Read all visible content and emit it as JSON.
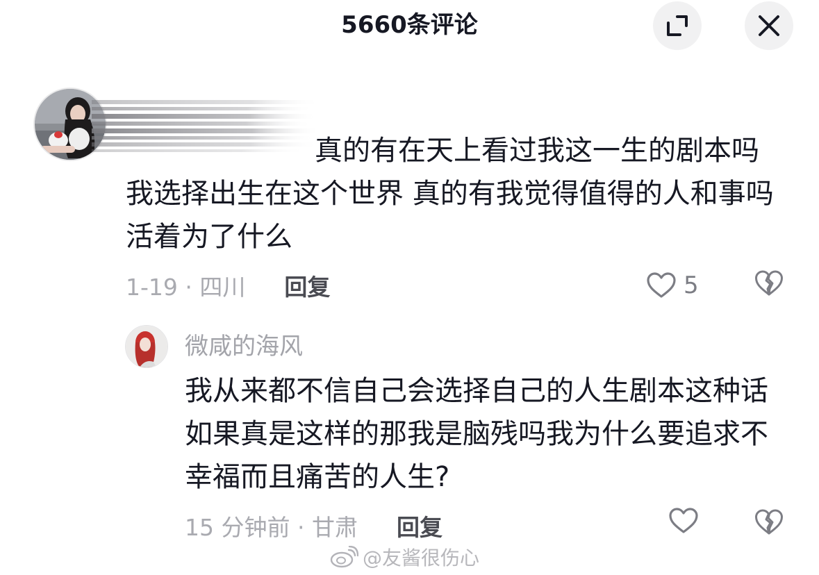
{
  "header": {
    "title": "5660条评论",
    "expand_icon": "expand-icon",
    "close_icon": "close-icon"
  },
  "comment": {
    "text_line1": "真的有在天上看过我这一生的剧",
    "text_rest": "本吗 我选择出生在这个世界 真的有我觉得值得的人和事吗 活着为了什么",
    "meta": "1-19 · 四川",
    "reply_label": "回复",
    "like_count": "5"
  },
  "reply": {
    "username": "微咸的海风",
    "text": "我从来都不信自己会选择自己的人生剧本这种话如果真是这样的那我是脑残吗我为什么要追求不幸福而且痛苦的人生?",
    "meta": "15 分钟前 · 甘肃",
    "reply_label": "回复"
  },
  "watermark": {
    "text": "@友酱很伤心"
  },
  "colors": {
    "text_primary": "#161823",
    "text_secondary": "#a9aab0",
    "button_bg": "#f1f1f2"
  }
}
